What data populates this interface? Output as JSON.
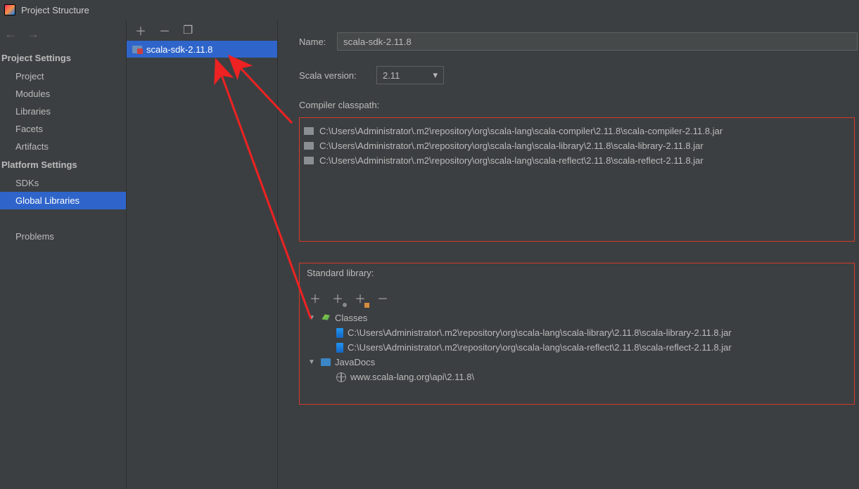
{
  "window": {
    "title": "Project Structure"
  },
  "sidebar": {
    "sections": [
      {
        "heading": "Project Settings",
        "items": [
          {
            "label": "Project"
          },
          {
            "label": "Modules"
          },
          {
            "label": "Libraries"
          },
          {
            "label": "Facets"
          },
          {
            "label": "Artifacts"
          }
        ]
      },
      {
        "heading": "Platform Settings",
        "items": [
          {
            "label": "SDKs"
          },
          {
            "label": "Global Libraries",
            "selected": true
          }
        ]
      }
    ],
    "problems_label": "Problems"
  },
  "library_list": {
    "items": [
      {
        "label": "scala-sdk-2.11.8",
        "selected": true
      }
    ]
  },
  "details": {
    "name_label": "Name:",
    "name_value": "scala-sdk-2.11.8",
    "scala_version_label": "Scala version:",
    "scala_version_value": "2.11",
    "compiler_classpath_label": "Compiler classpath:",
    "compiler_classpath": [
      "C:\\Users\\Administrator\\.m2\\repository\\org\\scala-lang\\scala-compiler\\2.11.8\\scala-compiler-2.11.8.jar",
      "C:\\Users\\Administrator\\.m2\\repository\\org\\scala-lang\\scala-library\\2.11.8\\scala-library-2.11.8.jar",
      "C:\\Users\\Administrator\\.m2\\repository\\org\\scala-lang\\scala-reflect\\2.11.8\\scala-reflect-2.11.8.jar"
    ],
    "standard_library_label": "Standard library:",
    "classes_label": "Classes",
    "classes_paths": [
      "C:\\Users\\Administrator\\.m2\\repository\\org\\scala-lang\\scala-library\\2.11.8\\scala-library-2.11.8.jar",
      "C:\\Users\\Administrator\\.m2\\repository\\org\\scala-lang\\scala-reflect\\2.11.8\\scala-reflect-2.11.8.jar"
    ],
    "javadocs_label": "JavaDocs",
    "javadocs_paths": [
      "www.scala-lang.org\\api\\2.11.8\\"
    ]
  }
}
